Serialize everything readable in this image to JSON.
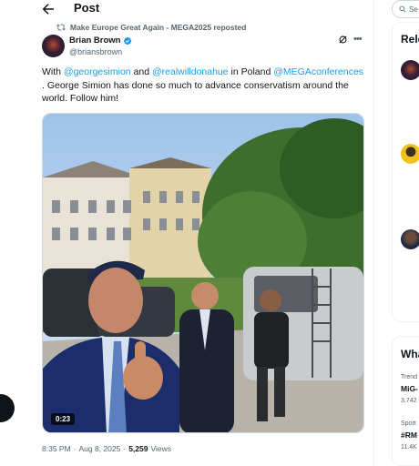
{
  "header": {
    "title": "Post"
  },
  "repost": {
    "text": "Make Europe Great Again - MEGA2025 reposted"
  },
  "author": {
    "name": "Brian Brown",
    "handle": "@briansbrown"
  },
  "tweet": {
    "t1": "With ",
    "m1": "@georgesimion",
    "t2": " and ",
    "m2": "@realwilldonahue",
    "t3": " in Poland ",
    "m3": "@MEGAconferences",
    "t4": " .  George Simion has done so much to advance conservatism around the world. Follow him!"
  },
  "media": {
    "duration": "0:23"
  },
  "meta": {
    "time": "8:35 PM",
    "sep": "·",
    "date": "Aug 8, 2025",
    "sep2": "·",
    "views_count": "5,259",
    "views_label": "Views"
  },
  "sidebar": {
    "search_placeholder": "Se",
    "relevant_heading": "Rele",
    "whats_heading": "Wha",
    "trends": [
      {
        "small": "Trend",
        "big": "MiG-",
        "count": "3,742"
      },
      {
        "small": "Sport",
        "big": "#RM",
        "count": "11.4K"
      }
    ]
  },
  "icons": {
    "back": "arrow-left-icon",
    "repost": "repost-icon",
    "verified": "verified-badge-icon",
    "grok": "grok-icon",
    "more": "more-icon",
    "search": "search-icon"
  },
  "colors": {
    "accent": "#1d9bf0",
    "text": "#0f1419",
    "muted": "#536471"
  }
}
